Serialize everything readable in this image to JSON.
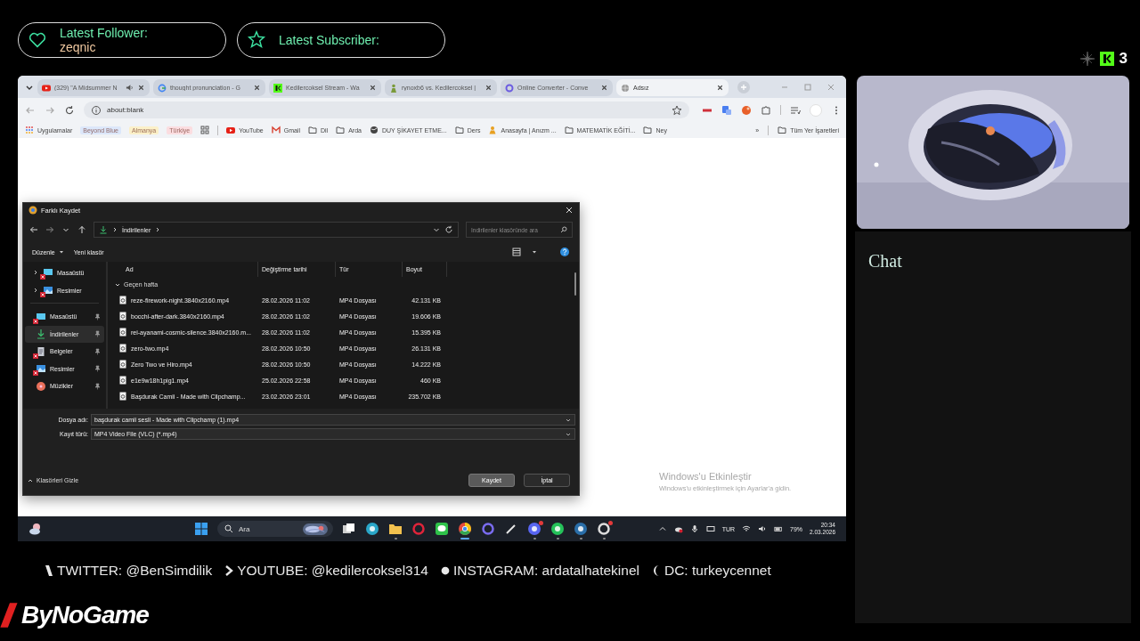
{
  "alerts": [
    {
      "kind": "follower",
      "label": "Latest Follower:",
      "value": "zeqnic"
    },
    {
      "kind": "subscriber",
      "label": "Latest Subscriber:"
    }
  ],
  "kick": {
    "viewers": "3"
  },
  "browser": {
    "tabs": [
      {
        "title": "(329) \"A Midsummer N",
        "kind": "youtube",
        "audio": true,
        "selected": false
      },
      {
        "title": "thought pronunciation - G",
        "kind": "google",
        "audio": false,
        "selected": false
      },
      {
        "title": "Kedilercoksel Stream - Wa",
        "kind": "kick",
        "audio": false,
        "selected": false
      },
      {
        "title": "rynoxb6 vs. Kedilercoksel |",
        "kind": "figure",
        "audio": false,
        "selected": false
      },
      {
        "title": "Online Converter - Conve",
        "kind": "converter",
        "audio": false,
        "selected": false
      },
      {
        "title": "Adsız",
        "kind": "globe",
        "audio": false,
        "selected": true
      }
    ],
    "address": "about:blank",
    "bookmarks": [
      {
        "label": "Uygulamalar",
        "kind": "apps"
      },
      {
        "label": "Beyond Blue",
        "kind": "chip",
        "color": "#dce7fa"
      },
      {
        "label": "Almanya",
        "kind": "chip",
        "color": "#fbf0c8"
      },
      {
        "label": "Türkiye",
        "kind": "chip",
        "color": "#fbdde0"
      },
      {
        "kind": "grid"
      },
      {
        "label": "YouTube",
        "kind": "youtube"
      },
      {
        "label": "Gmail",
        "kind": "mail"
      },
      {
        "label": "Dil",
        "kind": "folder"
      },
      {
        "label": "Arda",
        "kind": "folder"
      },
      {
        "label": "DUY ŞİKAYET ETME...",
        "kind": "globe"
      },
      {
        "label": "Ders",
        "kind": "folder"
      },
      {
        "label": "Anasayfa | Anızm ...",
        "kind": "figure"
      },
      {
        "label": "MATEMATİK EĞİTİ...",
        "kind": "folder"
      },
      {
        "label": "Ney",
        "kind": "folder"
      }
    ],
    "overflow": "»",
    "all_bookmarks": "Tüm Yer İşaretleri"
  },
  "dialog": {
    "title": "Farklı Kaydet",
    "path": "İndirilenler",
    "search": {
      "placeholder": "İndirilenler klasöründe ara"
    },
    "toolbar": [
      {
        "label": "Düzenle",
        "dropdown": true
      },
      {
        "label": "Yeni klasör",
        "dropdown": false
      }
    ],
    "tree": [
      {
        "label": "Masaüstü",
        "kind": "desktop",
        "error": true,
        "expanded": false
      },
      {
        "label": "Resimler",
        "kind": "pictures",
        "error": true,
        "expanded": false
      }
    ],
    "quick_access": [
      {
        "label": "Masaüstü",
        "kind": "desktop",
        "error": true,
        "pinned": true,
        "selected": false
      },
      {
        "label": "İndirilenler",
        "kind": "downloads",
        "error": false,
        "pinned": true,
        "selected": true
      },
      {
        "label": "Belgeler",
        "kind": "documents",
        "error": true,
        "pinned": true,
        "selected": false
      },
      {
        "label": "Resimler",
        "kind": "pictures",
        "error": true,
        "pinned": true,
        "selected": false
      },
      {
        "label": "Müzikler",
        "kind": "music",
        "error": false,
        "pinned": true,
        "selected": false
      }
    ],
    "columns": [
      "Ad",
      "Değiştirme tarihi",
      "Tür",
      "Boyut"
    ],
    "group": {
      "label": "Geçen hafta",
      "expanded": true
    },
    "files": [
      {
        "name": "reze-firework-night.3840x2160.mp4",
        "modified": "28.02.2026 11:02",
        "type": "MP4 Dosyası",
        "size": "42.131 KB"
      },
      {
        "name": "bocchi-after-dark.3840x2160.mp4",
        "modified": "28.02.2026 11:02",
        "type": "MP4 Dosyası",
        "size": "19.606 KB"
      },
      {
        "name": "rei-ayanami-cosmic-silence.3840x2160.m...",
        "modified": "28.02.2026 11:02",
        "type": "MP4 Dosyası",
        "size": "15.395 KB"
      },
      {
        "name": "zero-two.mp4",
        "modified": "28.02.2026 10:50",
        "type": "MP4 Dosyası",
        "size": "26.131 KB"
      },
      {
        "name": "Zero Two ve Hiro.mp4",
        "modified": "28.02.2026 10:50",
        "type": "MP4 Dosyası",
        "size": "14.222 KB"
      },
      {
        "name": "e1e9w18h1pig1.mp4",
        "modified": "25.02.2026 22:58",
        "type": "MP4 Dosyası",
        "size": "460 KB"
      },
      {
        "name": "Başdurak Camii - Made with Clipchamp...",
        "modified": "23.02.2026 23:01",
        "type": "MP4 Dosyası",
        "size": "235.702 KB"
      }
    ],
    "filename": {
      "label": "Dosya adı:",
      "value": "başdurak camii sesli - Made with Clipchamp (1).mp4"
    },
    "filetype": {
      "label": "Kayıt türü:",
      "value": "MP4 Video File (VLC) (*.mp4)"
    },
    "hide_folders": "Klasörleri Gizle",
    "buttons": [
      {
        "label": "Kaydet",
        "kind": "primary"
      },
      {
        "label": "İptal",
        "kind": "secondary"
      }
    ]
  },
  "activation": {
    "title": "Windows'u Etkinleştir",
    "hint": "Windows'u etkinleştirmek için Ayarlar'a gidin."
  },
  "taskbar": {
    "search": {
      "placeholder": "Ara"
    },
    "apps": [
      {
        "kind": "windows",
        "active": false,
        "running": false,
        "badge": false
      },
      {
        "kind": "taskview",
        "active": false,
        "running": false,
        "badge": false
      },
      {
        "kind": "edge",
        "active": false,
        "running": false,
        "badge": false
      },
      {
        "kind": "explorer",
        "active": false,
        "running": true,
        "badge": false
      },
      {
        "kind": "opera",
        "active": false,
        "running": false,
        "badge": false
      },
      {
        "kind": "line",
        "active": false,
        "running": false,
        "badge": false
      },
      {
        "kind": "chrome",
        "active": true,
        "running": true,
        "badge": false
      },
      {
        "kind": "ring",
        "active": false,
        "running": false,
        "badge": false
      },
      {
        "kind": "pen",
        "active": false,
        "running": false,
        "badge": false
      },
      {
        "kind": "discord",
        "active": false,
        "running": true,
        "badge": true
      },
      {
        "kind": "whatsapp",
        "active": false,
        "running": true,
        "badge": false
      },
      {
        "kind": "steam",
        "active": false,
        "running": true,
        "badge": false
      },
      {
        "kind": "obs",
        "active": false,
        "running": true,
        "badge": true
      }
    ],
    "tray": {
      "language": "TUR",
      "battery": "79%",
      "time": "20:34",
      "date": "2.03.2026"
    }
  },
  "chat": {
    "title": "Chat"
  },
  "socials": [
    {
      "kind": "twitter",
      "text": "TWITTER: @BenSimdilik"
    },
    {
      "kind": "youtube",
      "text": "YOUTUBE: @kedilercoksel314"
    },
    {
      "kind": "instagram",
      "text": "INSTAGRAM: ardatalhatekinel"
    },
    {
      "kind": "discord",
      "text": "DC: turkeycennet"
    }
  ],
  "logo": {
    "text": "ByNoGame"
  }
}
